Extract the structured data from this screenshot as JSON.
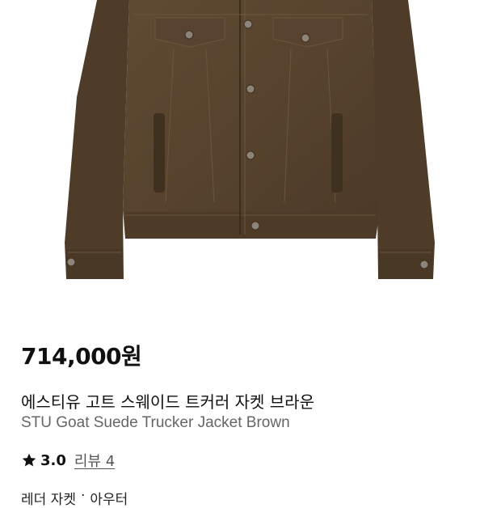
{
  "product": {
    "price": "714,000원",
    "name_ko": "에스티유 고트 스웨이드 트커러 자켓 브라운",
    "name_en": "STU Goat Suede Trucker Jacket Brown",
    "image_icon": "jacket-image"
  },
  "rating": {
    "icon": "star-icon",
    "value": "3.0",
    "review_label": "리뷰 4"
  },
  "category": {
    "items": [
      "레더 자켓",
      "아우터"
    ],
    "separator": "·"
  },
  "colors": {
    "suede": "#5a4630",
    "suede_dark": "#3f301f",
    "price_text": "#111111",
    "subtle_text": "#666666"
  }
}
